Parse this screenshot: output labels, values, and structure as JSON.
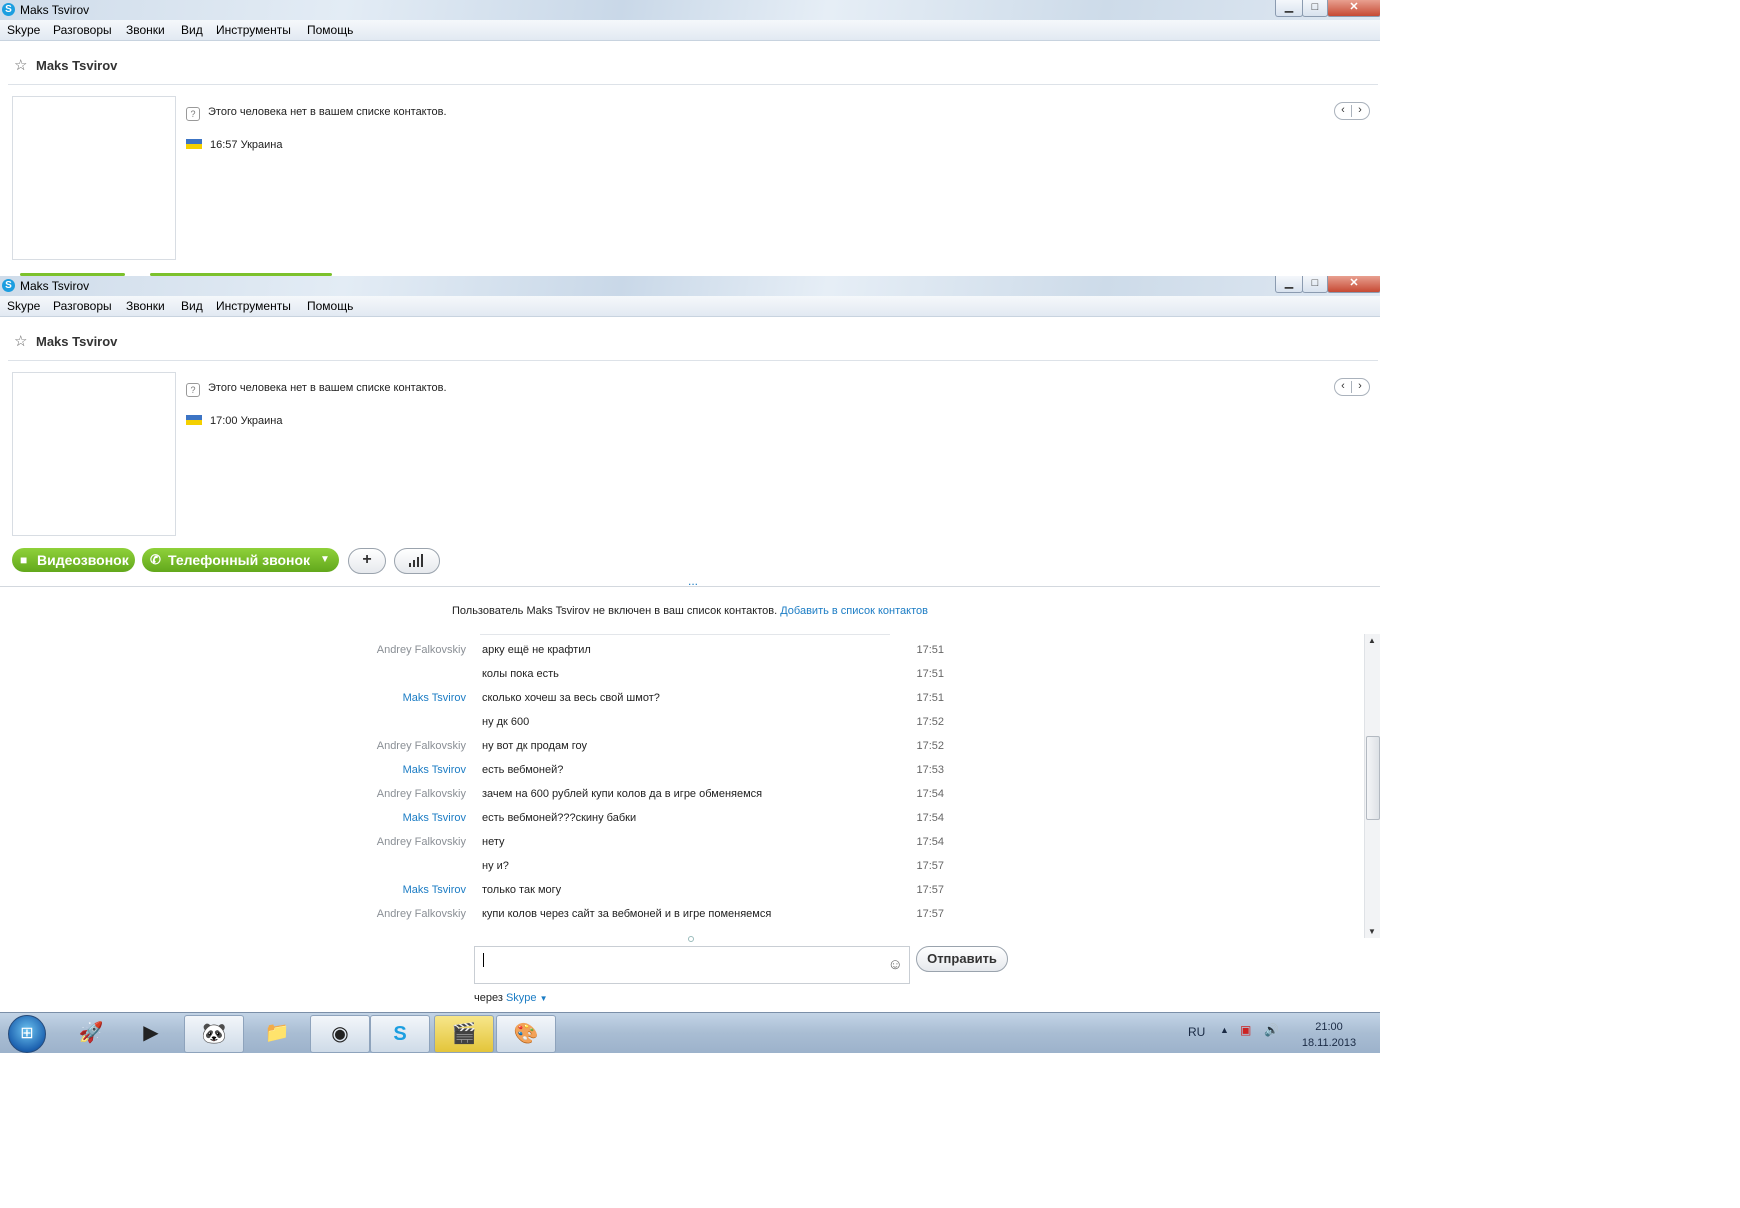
{
  "window_title": "Maks Tsvirov",
  "app_icon": "skype-icon",
  "window_controls": {
    "minimize": "▁",
    "maximize": "□",
    "close": "✕"
  },
  "menu": [
    "Skype",
    "Разговоры",
    "Звонки",
    "Вид",
    "Инструменты",
    "Помощь"
  ],
  "contact": {
    "name": "Maks Tsvirov",
    "not_in_contacts": "Этого человека нет в вашем списке контактов.",
    "location": "Украина",
    "local_time_1": "16:57",
    "local_time_2": "17:00"
  },
  "call_buttons": {
    "video": "Видеозвонок",
    "phone": "Телефонный звонок",
    "add": "+",
    "signal_icon": "signal-bars-icon"
  },
  "expand_handle": "...",
  "chat_notice": {
    "text": "Пользователь Maks Tsvirov не включен в ваш список контактов.",
    "link": "Добавить в список контактов"
  },
  "messages": [
    {
      "sender": "Andrey Falkovskiy",
      "text": "арку ещё не крафтил",
      "time": "17:51",
      "color": "grey"
    },
    {
      "sender": "",
      "text": "колы пока есть",
      "time": "17:51",
      "color": "grey"
    },
    {
      "sender": "Maks Tsvirov",
      "text": "сколько хочеш за весь свой шмот?",
      "time": "17:51",
      "color": "blue"
    },
    {
      "sender": "",
      "text": "ну дк 600",
      "time": "17:52",
      "color": "blue"
    },
    {
      "sender": "Andrey Falkovskiy",
      "text": "ну вот дк продам гоу",
      "time": "17:52",
      "color": "grey"
    },
    {
      "sender": "Maks Tsvirov",
      "text": "есть вебмоней?",
      "time": "17:53",
      "color": "blue"
    },
    {
      "sender": "Andrey Falkovskiy",
      "text": "зачем на 600 рублей купи колов да в игре обменяемся",
      "time": "17:54",
      "color": "grey"
    },
    {
      "sender": "Maks Tsvirov",
      "text": "есть вебмоней???скину бабки",
      "time": "17:54",
      "color": "blue"
    },
    {
      "sender": "Andrey Falkovskiy",
      "text": "нету",
      "time": "17:54",
      "color": "grey"
    },
    {
      "sender": "",
      "text": "ну и?",
      "time": "17:57",
      "color": "grey"
    },
    {
      "sender": "Maks Tsvirov",
      "text": "только так могу",
      "time": "17:57",
      "color": "blue"
    },
    {
      "sender": "Andrey Falkovskiy",
      "text": "купи колов через сайт за вебмоней и в игре поменяемся",
      "time": "17:57",
      "color": "grey"
    }
  ],
  "compose": {
    "send_label": "Отправить",
    "via_prefix": "через",
    "via_app": "Skype",
    "emoticon_icon": "smiley-icon"
  },
  "taskbar": {
    "items": [
      "launcher-icon",
      "media-player-icon",
      "panda-app-icon",
      "file-explorer-icon",
      "chrome-icon",
      "skype-icon",
      "video-editor-icon",
      "paint-icon"
    ],
    "language": "RU",
    "time": "21:00",
    "date": "18.11.2013"
  }
}
